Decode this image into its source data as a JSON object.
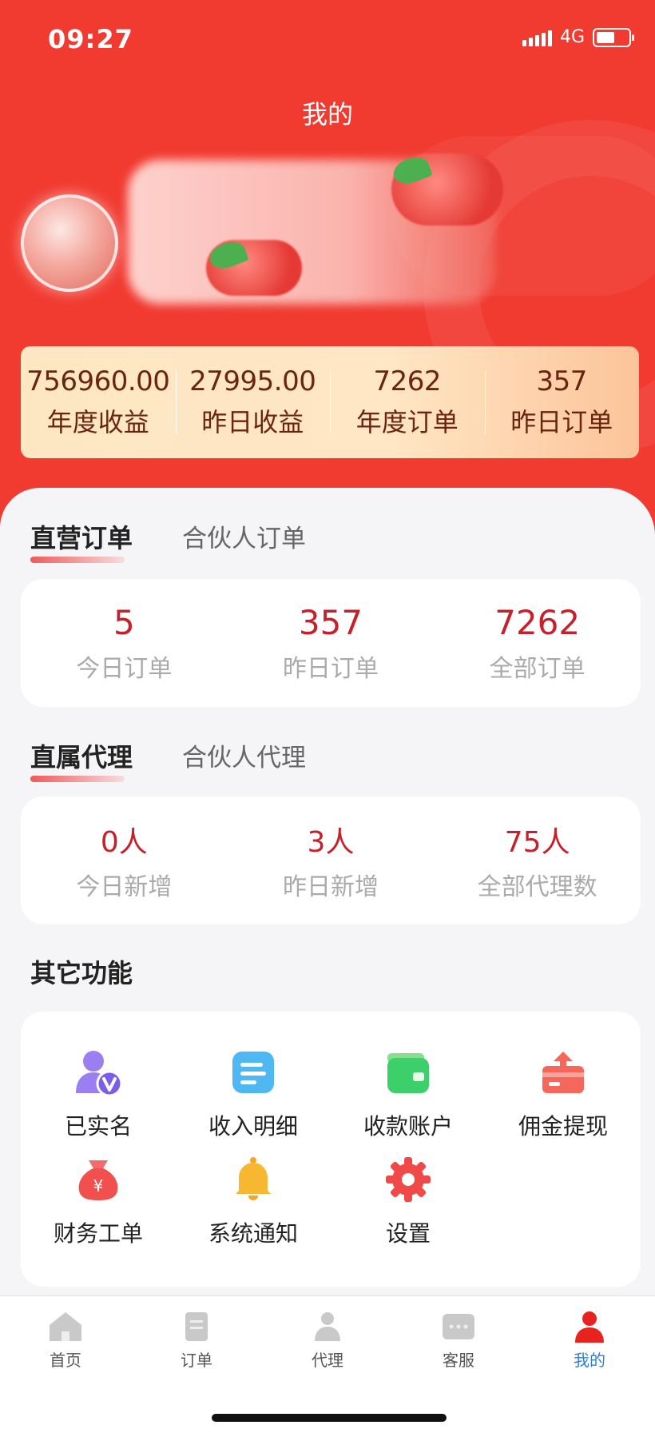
{
  "status_bar": {
    "time": "09:27",
    "network": "4G"
  },
  "header": {
    "title": "我的"
  },
  "stats": [
    {
      "value": "756960.00",
      "label": "年度收益"
    },
    {
      "value": "27995.00",
      "label": "昨日收益"
    },
    {
      "value": "7262",
      "label": "年度订单"
    },
    {
      "value": "357",
      "label": "昨日订单"
    }
  ],
  "orders": {
    "tab_active": "直营订单",
    "tab_inactive": "合伙人订单",
    "metrics": [
      {
        "value": "5",
        "label": "今日订单"
      },
      {
        "value": "357",
        "label": "昨日订单"
      },
      {
        "value": "7262",
        "label": "全部订单"
      }
    ]
  },
  "agents": {
    "tab_active": "直属代理",
    "tab_inactive": "合伙人代理",
    "metrics": [
      {
        "value": "0人",
        "label": "今日新增"
      },
      {
        "value": "3人",
        "label": "昨日新增"
      },
      {
        "value": "75人",
        "label": "全部代理数"
      }
    ]
  },
  "functions": {
    "title": "其它功能",
    "items": [
      {
        "label": "已实名",
        "icon": "verified-user-icon"
      },
      {
        "label": "收入明细",
        "icon": "document-list-icon"
      },
      {
        "label": "收款账户",
        "icon": "wallet-icon"
      },
      {
        "label": "佣金提现",
        "icon": "withdraw-icon"
      },
      {
        "label": "财务工单",
        "icon": "money-bag-icon"
      },
      {
        "label": "系统通知",
        "icon": "bell-icon"
      },
      {
        "label": "设置",
        "icon": "gear-icon"
      }
    ]
  },
  "bottom_nav": [
    {
      "label": "首页",
      "icon": "home-icon"
    },
    {
      "label": "订单",
      "icon": "order-icon"
    },
    {
      "label": "代理",
      "icon": "agent-icon"
    },
    {
      "label": "客服",
      "icon": "chat-icon"
    },
    {
      "label": "我的",
      "icon": "user-icon",
      "active": true
    }
  ],
  "colors": {
    "primary_red": "#f13a30",
    "value_red": "#c8202a",
    "nav_active": "#2f7fd8"
  }
}
